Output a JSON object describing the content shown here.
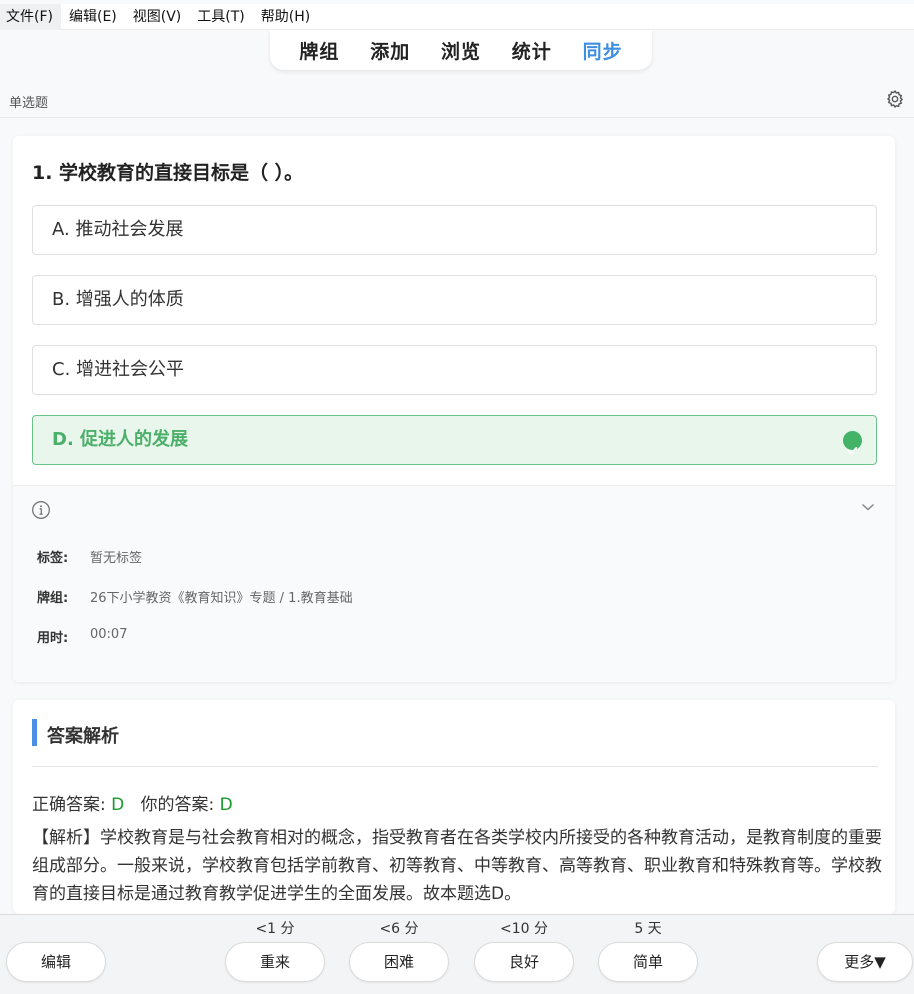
{
  "menu": [
    "文件(F)",
    "编辑(E)",
    "视图(V)",
    "工具(T)",
    "帮助(H)"
  ],
  "tabs": [
    {
      "label": "牌组",
      "active": false
    },
    {
      "label": "添加",
      "active": false
    },
    {
      "label": "浏览",
      "active": false
    },
    {
      "label": "统计",
      "active": false
    },
    {
      "label": "同步",
      "active": true
    }
  ],
  "subheader": {
    "title": "单选题"
  },
  "question": {
    "title": "1. 学校教育的直接目标是（ ）。",
    "options": [
      {
        "label": "A. 推动社会发展",
        "correct": false
      },
      {
        "label": "B. 增强人的体质",
        "correct": false
      },
      {
        "label": "C. 增进社会公平",
        "correct": false
      },
      {
        "label": "D. 促进人的发展",
        "correct": true
      }
    ]
  },
  "meta": {
    "tags_label": "标签:",
    "tags_value": "暂无标签",
    "deck_label": "牌组:",
    "deck_value": "26下小学教资《教育知识》专题 / 1.教育基础",
    "time_label": "用时:",
    "time_value": "00:07"
  },
  "answer": {
    "heading": "答案解析",
    "correct_label": "正确答案:",
    "correct_value": "D",
    "yours_label": "你的答案:",
    "yours_value": "D",
    "explanation": "【解析】学校教育是与社会教育相对的概念，指受教育者在各类学校内所接受的各种教育活动，是教育制度的重要组成部分。一般来说，学校教育包括学前教育、初等教育、中等教育、高等教育、职业教育和特殊教育等。学校教育的直接目标是通过教育教学促进学生的全面发展。故本题选D。"
  },
  "bottom": {
    "edit": "编辑",
    "more": "更多▼",
    "grades": [
      {
        "time": "<1 分",
        "label": "重来"
      },
      {
        "time": "<6 分",
        "label": "困难"
      },
      {
        "time": "<10 分",
        "label": "良好"
      },
      {
        "time": "5 天",
        "label": "简单"
      }
    ]
  },
  "colors": {
    "accent": "#3f8fe0",
    "correct": "#43b367",
    "answer_green": "#1a9a2a"
  }
}
